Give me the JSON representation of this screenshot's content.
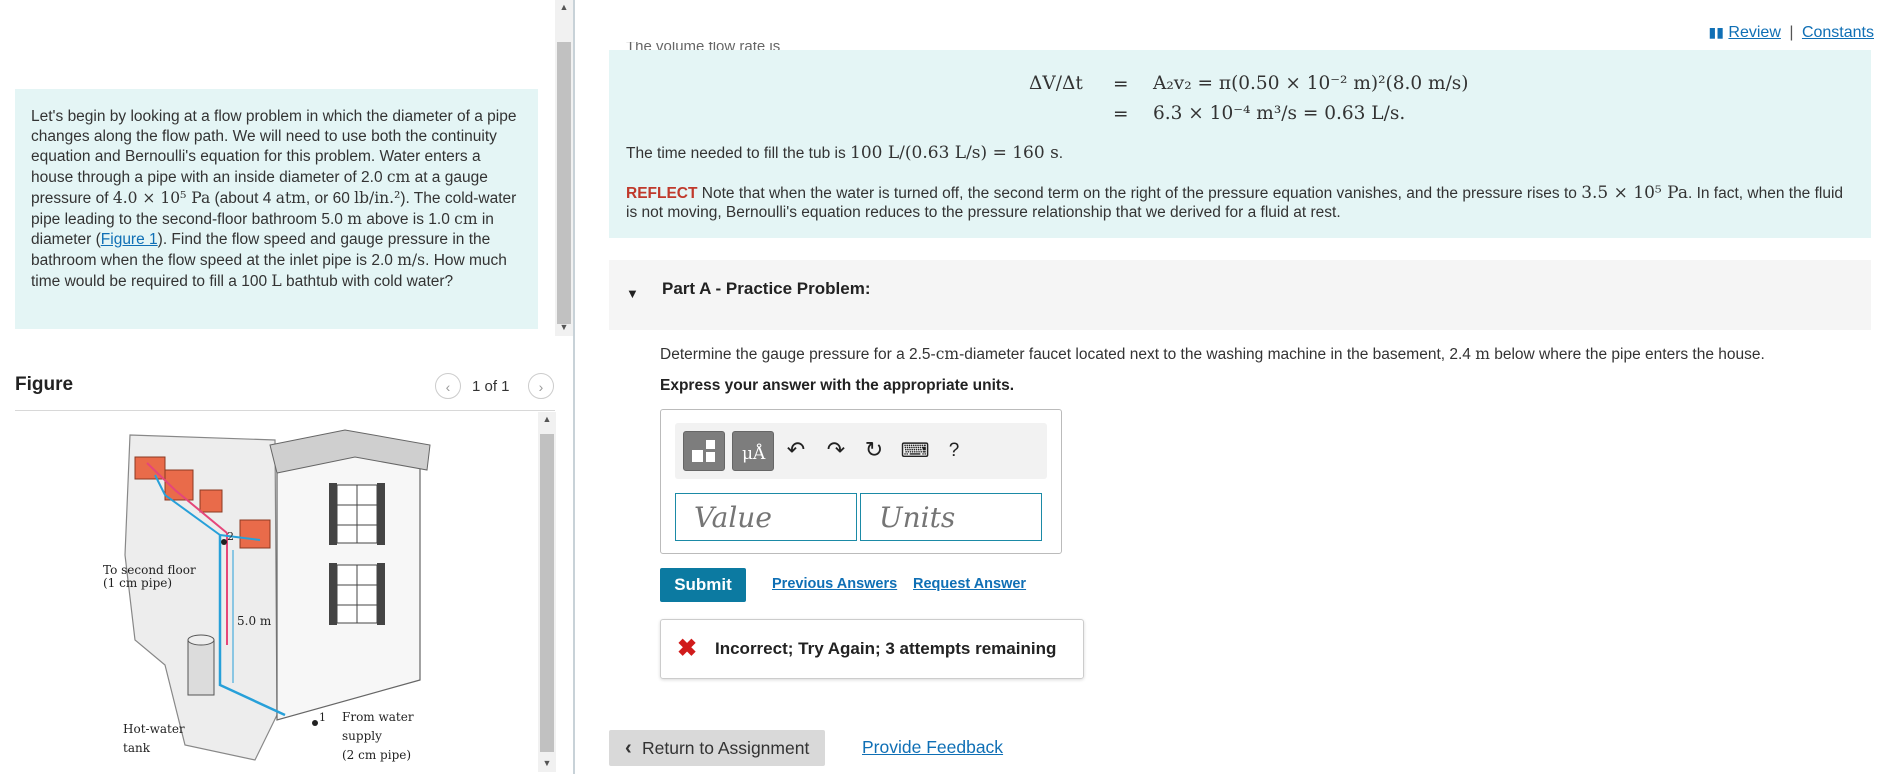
{
  "header": {
    "review_label": "Review",
    "separator": "|",
    "constants_label": "Constants"
  },
  "intro": {
    "p1": "Let's begin by looking at a flow problem in which the diameter of a pipe changes along the flow path. We will need to use both the continuity equation and Bernoulli's equation for this problem. Water enters a house through a pipe with an inside diameter of 2.0 ",
    "cm": "cm",
    "p2": " at a gauge pressure of ",
    "pressure": "4.0 × 10⁵ Pa",
    "p3": " (about 4 ",
    "atm": "atm",
    "p4": ", or 60 ",
    "psi": "lb/in.²",
    "p5": "). The cold-water pipe leading to the second-floor bathroom 5.0 ",
    "m": "m",
    "p6": " above is 1.0 ",
    "cm2": "cm",
    "p7": " in diameter (",
    "figure_link": "Figure 1",
    "p8": "). Find the flow speed and gauge pressure in the bathroom when the flow speed at the inlet pipe is 2.0 ",
    "ms": "m/s",
    "p9": ". How much time would be required to fill a 100 ",
    "L": "L",
    "p10": " bathtub with cold water?"
  },
  "figure": {
    "title": "Figure",
    "count": "1 of 1",
    "labels": {
      "to_second_floor": "To second floor",
      "pipe_1cm": "(1 cm pipe)",
      "height": "5.0 m",
      "point2": "2",
      "point1": "1",
      "hot_water": "Hot-water",
      "tank": "tank",
      "from_water": "From water",
      "supply": "supply",
      "pipe_2cm": "(2 cm pipe)"
    }
  },
  "solution": {
    "cut_text": "The volume flow rate is",
    "eq1_lhs": "ΔV/Δt",
    "eq_sign": "=",
    "eq1_rhs": "A₂v₂ = π(0.50 × 10⁻² m)²(8.0 m/s)",
    "eq2_rhs": "6.3 × 10⁻⁴ m³/s = 0.63 L/s.",
    "fill_text": "The time needed to fill the tub is ",
    "fill_math": "100 L/(0.63 L/s) = 160 s",
    "fill_end": ".",
    "reflect_tag": "REFLECT",
    "reflect_text1": " Note that when the water is turned off, the second term on the right of the pressure equation vanishes, and the pressure rises to ",
    "reflect_math": "3.5 × 10⁵ Pa",
    "reflect_text2": ". In fact, when the fluid is not moving, Bernoulli's equation reduces to the pressure relationship that we derived for a fluid at rest."
  },
  "partA": {
    "title": "Part A - Practice Problem:",
    "question1": "Determine the gauge pressure for a 2.5-",
    "cm": "cm",
    "question2": "-diameter faucet located next to the washing machine in the basement, 2.4 ",
    "m": "m",
    "question3": " below where the pipe enters the house.",
    "instructions": "Express your answer with the appropriate units.",
    "value_placeholder": "Value",
    "units_placeholder": "Units",
    "mu_label": "μÅ",
    "help_label": "?",
    "submit_label": "Submit",
    "previous_answers": "Previous Answers",
    "request_answer": "Request Answer",
    "feedback": "Incorrect; Try Again; 3 attempts remaining"
  },
  "footer": {
    "return_label": "Return to Assignment",
    "provide_feedback": "Provide Feedback"
  },
  "colors": {
    "accent": "#0c7aa1",
    "link": "#0f6fb5",
    "panel_bg": "#e4f5f5",
    "error": "#d01b1b",
    "reflect": "#c0392b"
  }
}
